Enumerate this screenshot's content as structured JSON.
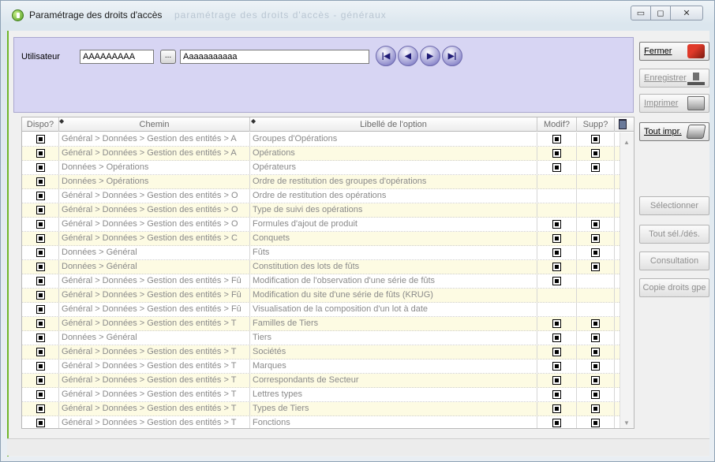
{
  "window": {
    "title": "Paramétrage des droits d'accès",
    "title_ghost": "paramétrage des droits d'accès - généraux",
    "controls": {
      "minimize": "▭",
      "maximize": "◻",
      "close": "✕"
    }
  },
  "header": {
    "user_label": "Utilisateur",
    "user_code": "AAAAAAAAA",
    "browse_label": "...",
    "user_name": "Aaaaaaaaaaa",
    "nav": {
      "first": "|◀",
      "prev": "◀",
      "next": "▶",
      "last": "▶|"
    }
  },
  "grid": {
    "columns": {
      "dispo": "Dispo?",
      "chemin": "Chemin",
      "libelle": "Libellé de l'option",
      "modif": "Modif?",
      "supp": "Supp?"
    },
    "rows": [
      {
        "dispo": true,
        "chemin": "Général > Données > Gestion des entités > A",
        "libelle": "Groupes d'Opérations",
        "modif": true,
        "supp": true
      },
      {
        "dispo": true,
        "chemin": "Général > Données > Gestion des entités > A",
        "libelle": "Opérations",
        "modif": true,
        "supp": true
      },
      {
        "dispo": true,
        "chemin": "Données > Opérations",
        "libelle": "Opérateurs",
        "modif": true,
        "supp": true
      },
      {
        "dispo": true,
        "chemin": "Données > Opérations",
        "libelle": "Ordre de restitution des groupes d'opérations",
        "modif": null,
        "supp": null
      },
      {
        "dispo": true,
        "chemin": "Général > Données > Gestion des entités > O",
        "libelle": "Ordre de restitution des opérations",
        "modif": null,
        "supp": null
      },
      {
        "dispo": true,
        "chemin": "Général > Données > Gestion des entités > O",
        "libelle": "Type de suivi des opérations",
        "modif": null,
        "supp": null
      },
      {
        "dispo": true,
        "chemin": "Général > Données > Gestion des entités > O",
        "libelle": "Formules d'ajout de produit",
        "modif": true,
        "supp": true
      },
      {
        "dispo": true,
        "chemin": "Général > Données > Gestion des entités > C",
        "libelle": "Conquets",
        "modif": true,
        "supp": true
      },
      {
        "dispo": true,
        "chemin": "Données > Général",
        "libelle": "Fûts",
        "modif": true,
        "supp": true
      },
      {
        "dispo": true,
        "chemin": "Données > Général",
        "libelle": "Constitution des lots de fûts",
        "modif": true,
        "supp": true
      },
      {
        "dispo": true,
        "chemin": "Général > Données > Gestion des entités > Fû",
        "libelle": "Modification de l'observation d'une série de fûts",
        "modif": true,
        "supp": null
      },
      {
        "dispo": true,
        "chemin": "Général > Données > Gestion des entités > Fû",
        "libelle": "Modification du site d'une série de fûts (KRUG)",
        "modif": null,
        "supp": null
      },
      {
        "dispo": true,
        "chemin": "Général > Données > Gestion des entités > Fû",
        "libelle": "Visualisation de la composition d'un lot à date",
        "modif": null,
        "supp": null
      },
      {
        "dispo": true,
        "chemin": "Général > Données > Gestion des entités > T",
        "libelle": "Familles de Tiers",
        "modif": true,
        "supp": true
      },
      {
        "dispo": true,
        "chemin": "Données > Général",
        "libelle": "Tiers",
        "modif": true,
        "supp": true
      },
      {
        "dispo": true,
        "chemin": "Général > Données > Gestion des entités > T",
        "libelle": "Sociétés",
        "modif": true,
        "supp": true
      },
      {
        "dispo": true,
        "chemin": "Général > Données > Gestion des entités > T",
        "libelle": "Marques",
        "modif": true,
        "supp": true
      },
      {
        "dispo": true,
        "chemin": "Général > Données > Gestion des entités > T",
        "libelle": "Correspondants de Secteur",
        "modif": true,
        "supp": true
      },
      {
        "dispo": true,
        "chemin": "Général > Données > Gestion des entités > T",
        "libelle": "Lettres types",
        "modif": true,
        "supp": true
      },
      {
        "dispo": true,
        "chemin": "Général > Données > Gestion des entités > T",
        "libelle": "Types de Tiers",
        "modif": true,
        "supp": true
      },
      {
        "dispo": true,
        "chemin": "Général > Données > Gestion des entités > T",
        "libelle": "Fonctions",
        "modif": true,
        "supp": true
      }
    ]
  },
  "buttons": {
    "fermer": "Fermer",
    "enregistrer": "Enregistrer",
    "imprimer": "Imprimer",
    "tout_impr": "Tout impr.",
    "selectionner": "Sélectionner",
    "tout_sel": "Tout sél./dés.",
    "consultation": "Consultation",
    "copie_droits": "Copie droits gpe"
  },
  "icons": {
    "app": "app-icon",
    "fermer": "exit-icon",
    "enregistrer": "save-icon",
    "imprimer": "printer-icon",
    "tout_impr": "print-all-icon",
    "trash": "trash-icon"
  },
  "colors": {
    "header_panel": "#d7d5f3",
    "row_alt": "#fdfbe3",
    "accent_green": "#6fb52a"
  }
}
